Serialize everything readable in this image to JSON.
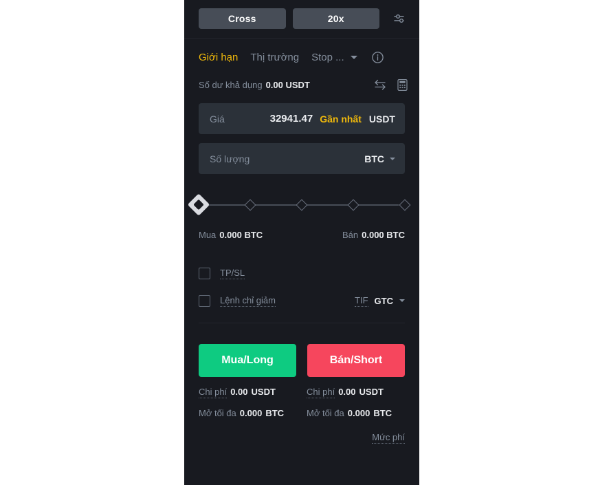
{
  "leverage": {
    "margin_mode_label": "Cross",
    "leverage_label": "20x",
    "settings_icon": "sliders-icon"
  },
  "order_types": {
    "tabs": [
      {
        "label": "Giới hạn",
        "active": true
      },
      {
        "label": "Thị trường",
        "active": false
      },
      {
        "label": "Stop ...",
        "active": false
      }
    ],
    "info_icon": "info-circle-icon",
    "dropdown_icon": "chevron-down-icon"
  },
  "balance": {
    "label": "Số dư khả dụng",
    "value": "0.00 USDT",
    "transfer_icon": "swap-arrows-icon",
    "calculator_icon": "calculator-icon"
  },
  "price_field": {
    "label": "Giá",
    "value": "32941.47",
    "tag": "Gần nhất",
    "unit": "USDT"
  },
  "amount_field": {
    "placeholder": "Số lượng",
    "value": "",
    "unit": "BTC",
    "dropdown_icon": "chevron-down-icon"
  },
  "slider": {
    "percent": 0,
    "steps": [
      0,
      25,
      50,
      75,
      100
    ]
  },
  "quantities": {
    "buy_label": "Mua",
    "buy_value": "0.000 BTC",
    "sell_label": "Bán",
    "sell_value": "0.000 BTC"
  },
  "options": {
    "tpsl_label": "TP/SL",
    "tpsl_checked": false,
    "reduce_only_label": "Lệnh chỉ giảm",
    "reduce_only_checked": false,
    "tif_label": "TIF",
    "tif_value": "GTC",
    "tif_dropdown_icon": "chevron-down-icon"
  },
  "actions": {
    "buy_label": "Mua/Long",
    "sell_label": "Bán/Short",
    "buy_color": "#0ecb81",
    "sell_color": "#f6465d"
  },
  "footer": {
    "cost_label": "Chi phí",
    "buy_cost_value": "0.00",
    "buy_cost_unit": "USDT",
    "sell_cost_value": "0.00",
    "sell_cost_unit": "USDT",
    "max_label": "Mở tối đa",
    "buy_max_value": "0.000",
    "buy_max_unit": "BTC",
    "sell_max_value": "0.000",
    "sell_max_unit": "BTC",
    "fee_link_label": "Mức phí"
  },
  "theme": {
    "accent": "#f0b90b",
    "panel_bg": "#181a20",
    "field_bg": "#2b3139",
    "muted_text": "#848e9c"
  }
}
